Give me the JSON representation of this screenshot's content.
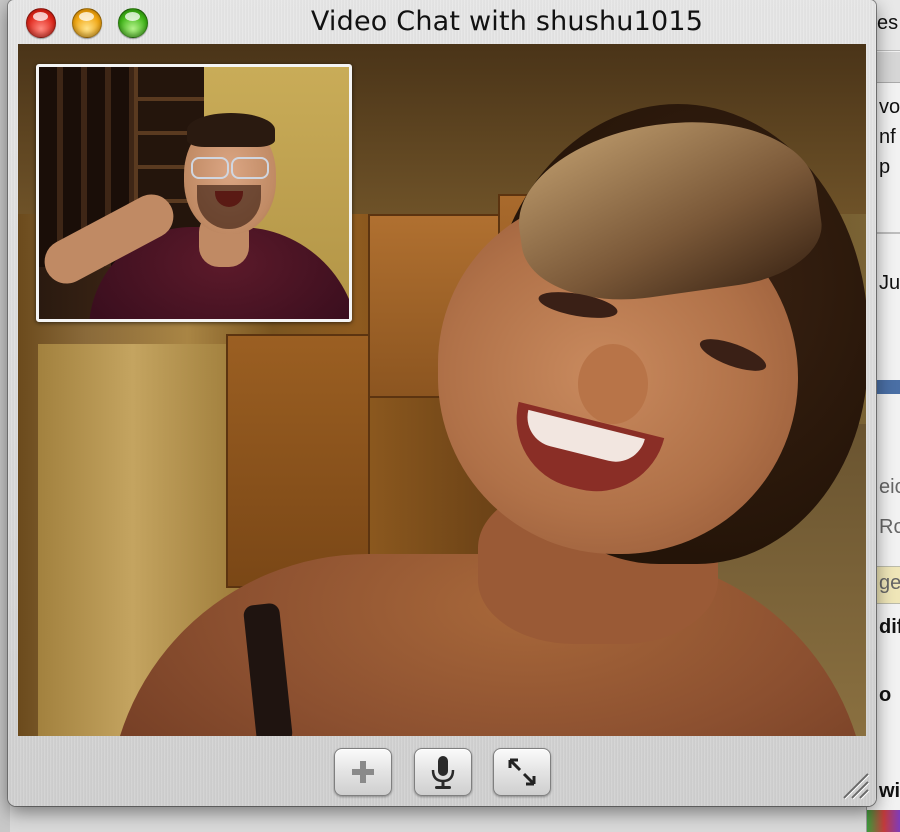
{
  "window": {
    "title": "Video Chat with shushu1015"
  },
  "traffic_lights": [
    {
      "name": "close",
      "color": "#e0261a"
    },
    {
      "name": "minimize",
      "color": "#f0a40e"
    },
    {
      "name": "zoom",
      "color": "#3fb517"
    }
  ],
  "toolbar": {
    "buttons": [
      {
        "name": "add-participant",
        "icon": "plus-icon"
      },
      {
        "name": "mute",
        "icon": "microphone-icon"
      },
      {
        "name": "fullscreen",
        "icon": "expand-arrows-icon"
      }
    ]
  },
  "background_window": {
    "fragments": [
      "es",
      "vo",
      "nf",
      "p",
      "Ju",
      "eic",
      "Ro",
      "ge",
      "dif",
      "o",
      "wi"
    ]
  }
}
